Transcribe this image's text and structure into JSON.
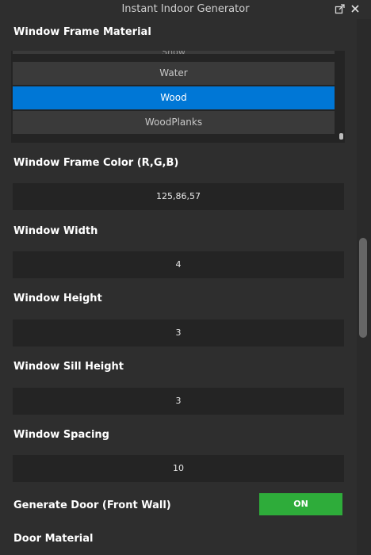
{
  "window": {
    "title": "Instant Indoor Generator",
    "icons": {
      "dock": "undock-icon",
      "close": "close-icon"
    }
  },
  "sections": {
    "frame_material": {
      "label": "Window Frame Material",
      "items": [
        "Snow",
        "Water",
        "Wood",
        "WoodPlanks"
      ],
      "selected": "Wood"
    },
    "frame_color": {
      "label": "Window Frame Color (R,G,B)",
      "value": "125,86,57"
    },
    "window_width": {
      "label": "Window Width",
      "value": "4"
    },
    "window_height": {
      "label": "Window Height",
      "value": "3"
    },
    "sill_height": {
      "label": "Window Sill Height",
      "value": "3"
    },
    "window_spacing": {
      "label": "Window Spacing",
      "value": "10"
    },
    "generate_door": {
      "label": "Generate Door (Front Wall)",
      "toggle": "ON"
    },
    "door_material": {
      "label": "Door Material"
    }
  },
  "colors": {
    "background": "#2e2e2e",
    "field": "#242424",
    "list_item": "#3a3a3a",
    "selected": "#0077d6",
    "toggle_on": "#2eac3a"
  }
}
